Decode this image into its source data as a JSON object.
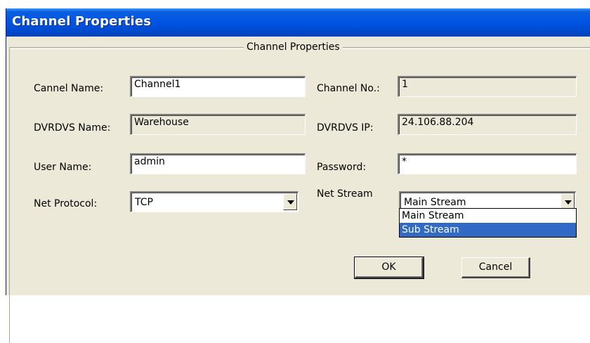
{
  "window": {
    "title": "Channel Properties"
  },
  "group": {
    "legend": "Channel Properties"
  },
  "fields": {
    "channel_name": {
      "label": "Cannel Name:",
      "value": "Channel1"
    },
    "channel_no": {
      "label": "Channel  No.:",
      "value": "1"
    },
    "dvrdvs_name": {
      "label": "DVRDVS Name:",
      "value": "Warehouse"
    },
    "dvrdvs_ip": {
      "label": "DVRDVS IP:",
      "value": "24.106.88.204"
    },
    "user_name": {
      "label": "User   Name:",
      "value": "admin"
    },
    "password": {
      "label": "Password:",
      "value": "*"
    },
    "net_protocol": {
      "label": "Net Protocol:",
      "value": "TCP"
    },
    "net_stream": {
      "label": "Net Stream",
      "value": "Main Stream"
    }
  },
  "net_stream_options": [
    "Main Stream",
    "Sub Stream"
  ],
  "buttons": {
    "ok": "OK",
    "cancel": "Cancel"
  }
}
